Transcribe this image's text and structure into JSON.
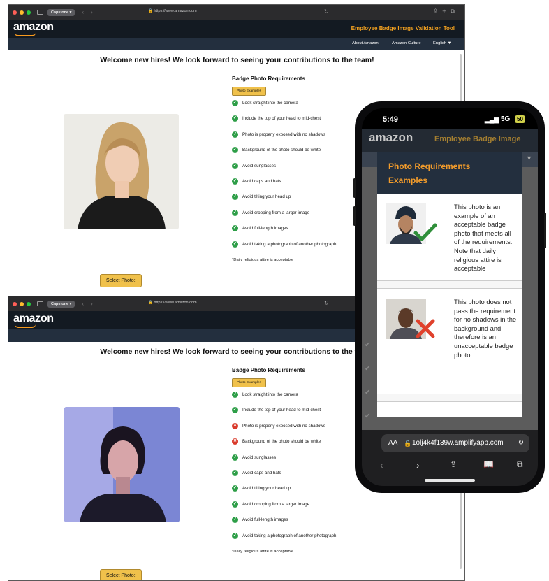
{
  "browser": {
    "tab_label": "Capstone",
    "url": "https://www.amazon.com"
  },
  "site": {
    "logo_text": "amazon",
    "tool_title": "Employee Badge Image Validation Tool",
    "nav_about": "About Amazon",
    "nav_culture": "Amazon Culture",
    "nav_language": "English ▼",
    "welcome": "Welcome new hires! We look forward to seeing your contributions to the team!",
    "requirements_title": "Badge Photo Requirements",
    "examples_button": "Photo Examples",
    "note": "*Daily religious attire is acceptable",
    "select_button": "Select Photo:"
  },
  "requirements": [
    "Look straight into the camera",
    "Include the top of your head to mid-chest",
    "Photo is properly exposed with no shadows",
    "Background of the photo should be white",
    "Avoid sunglasses",
    "Avoid caps and hats",
    "Avoid tilting your head up",
    "Avoid cropping from a larger image",
    "Avoid full-length images",
    "Avoid taking a photograph of another photograph"
  ],
  "status_window1": [
    "pass",
    "pass",
    "pass",
    "pass",
    "pass",
    "pass",
    "pass",
    "pass",
    "pass",
    "pass"
  ],
  "status_window2": [
    "pass",
    "pass",
    "fail",
    "fail",
    "pass",
    "pass",
    "pass",
    "pass",
    "pass",
    "pass"
  ],
  "colors": {
    "pass": "#2e9e48",
    "fail": "#d93a2b",
    "accent": "#f0a020",
    "navbar": "#131a22"
  },
  "phone": {
    "time": "5:49",
    "signal": "5G",
    "battery": "50",
    "header_logo": "amazon",
    "header_title": "Employee Badge Image",
    "modal_title_line1": "Photo Requirements",
    "modal_title_line2": "Examples",
    "example1_text": "This photo is an example of an acceptable badge photo that meets all of the requirements. Note that daily religious attire is acceptable",
    "example2_text": "This photo does not pass the requirement for no shadows in the background and therefore is an unacceptable badge photo.",
    "aa_label": "AA",
    "url": "1olj4k4f139w.amplifyapp.com"
  }
}
